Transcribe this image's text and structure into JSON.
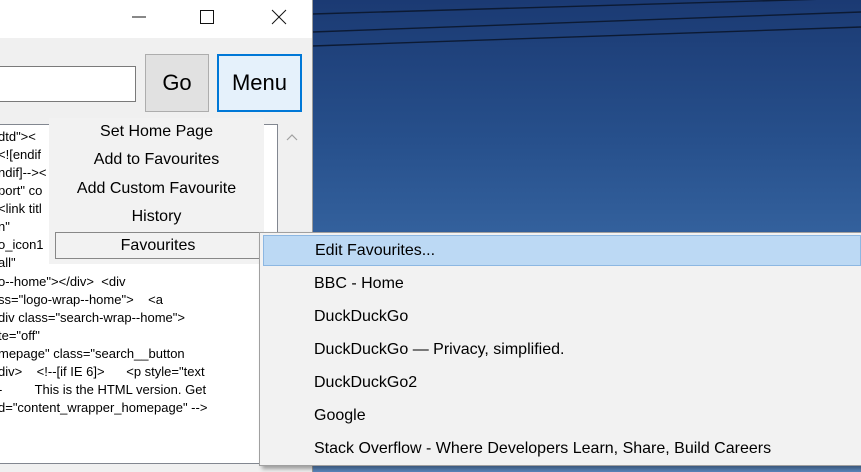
{
  "window": {
    "controls": {
      "minimize": "minimize-icon",
      "maximize": "maximize-icon",
      "close": "close-icon"
    }
  },
  "toolbar": {
    "url_value": "",
    "go_label": "Go",
    "menu_label": "Menu"
  },
  "source_lines": [
    "dtd\"><",
    "<![endif",
    "ndif]--><",
    "port\" co",
    "<link titl",
    "n\"",
    "o_icon1",
    "all\"",
    "o--home\"></div>  <div",
    "ss=\"logo-wrap--home\">    <a",
    "div class=\"search-wrap--home\">",
    "te=\"off\"",
    "mepage\" class=\"search__button",
    "div>    <!--[if IE 6]>      <p style=\"text",
    "-         This is the HTML version. Get",
    "d=\"content_wrapper_homepage\" -->"
  ],
  "menu": {
    "items": [
      "Set Home Page",
      "Add to Favourites",
      "Add Custom Favourite",
      "History",
      "Favourites"
    ],
    "active": "Favourites"
  },
  "favourites_submenu": {
    "items": [
      "Edit Favourites...",
      "BBC - Home",
      "DuckDuckGo",
      "DuckDuckGo — Privacy, simplified.",
      "DuckDuckGo2",
      "Google",
      "Stack Overflow - Where Developers Learn, Share,  Build Careers"
    ],
    "highlighted": "Edit Favourites..."
  },
  "colors": {
    "accent": "#0078d7",
    "highlight": "#bcd9f4"
  }
}
